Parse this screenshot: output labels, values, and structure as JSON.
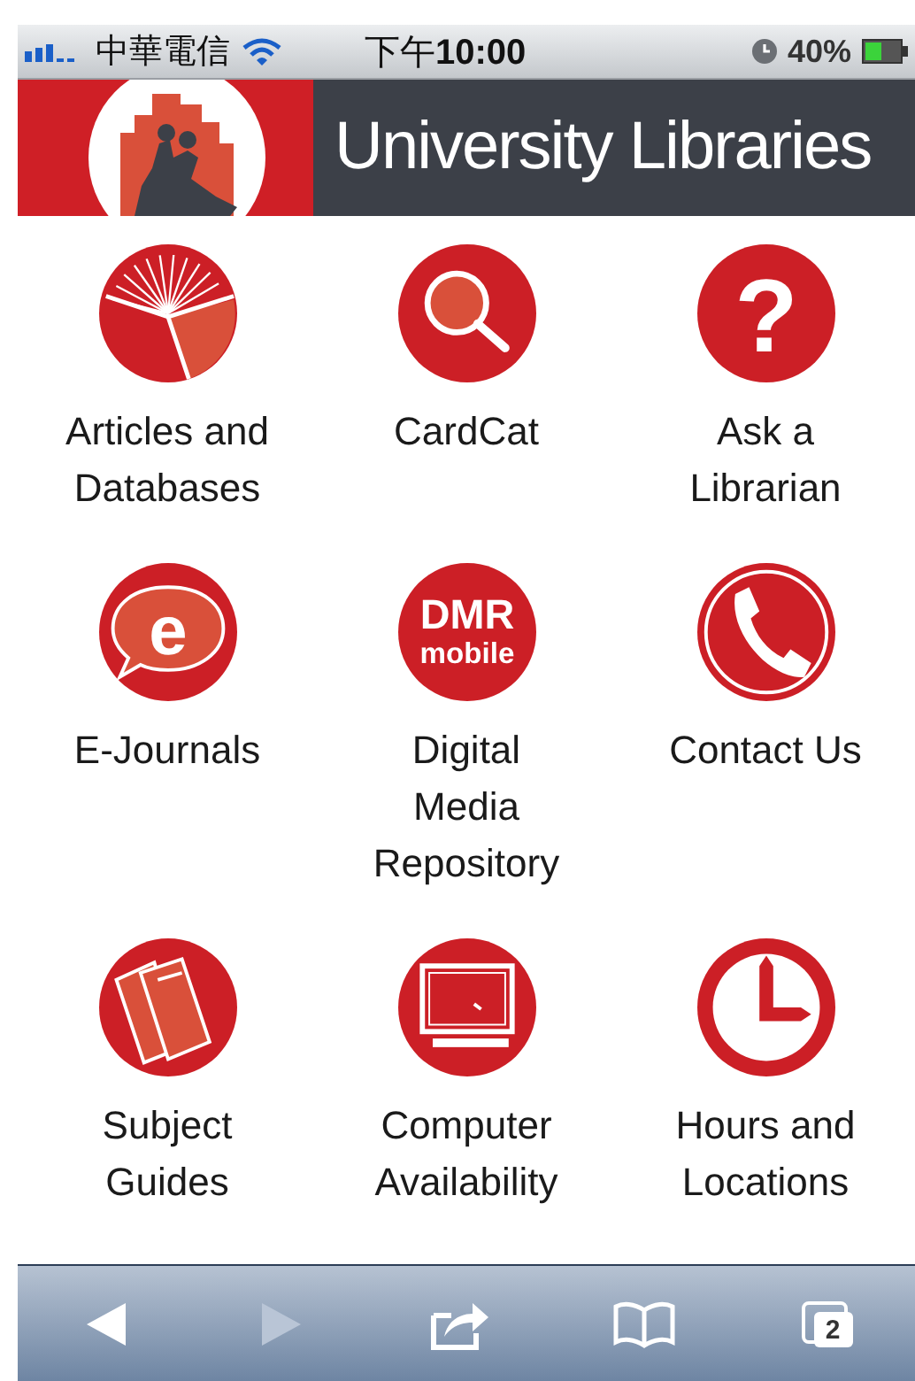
{
  "status_bar": {
    "carrier": "中華電信",
    "time": "下午**10:00**",
    "battery": "40%"
  },
  "header": {
    "title": "University Libraries"
  },
  "items": [
    {
      "kind": "book",
      "lines": [
        "Articles and",
        "Databases"
      ]
    },
    {
      "kind": "search",
      "lines": [
        "CardCat"
      ]
    },
    {
      "kind": "question",
      "glyph": "?",
      "lines": [
        "Ask a",
        "Librarian"
      ]
    },
    {
      "kind": "bubble",
      "glyph": "e",
      "lines": [
        "E-Journals"
      ]
    },
    {
      "kind": "dmr",
      "icon_text": [
        "DMR",
        "mobile"
      ],
      "lines": [
        "Digital",
        "Media",
        "Repository"
      ]
    },
    {
      "kind": "phone",
      "lines": [
        "Contact Us"
      ]
    },
    {
      "kind": "guides",
      "lines": [
        "Subject",
        "Guides"
      ]
    },
    {
      "kind": "computer",
      "lines": [
        "Computer",
        "Availability"
      ]
    },
    {
      "kind": "clock",
      "lines": [
        "Hours and",
        "Locations"
      ]
    }
  ],
  "toolbar": [
    {
      "kind": "back",
      "disabled": false
    },
    {
      "kind": "forward",
      "disabled": true
    },
    {
      "kind": "share",
      "disabled": false
    },
    {
      "kind": "bookmarks",
      "disabled": false
    },
    {
      "kind": "tabs",
      "badge": "2",
      "disabled": false
    }
  ]
}
